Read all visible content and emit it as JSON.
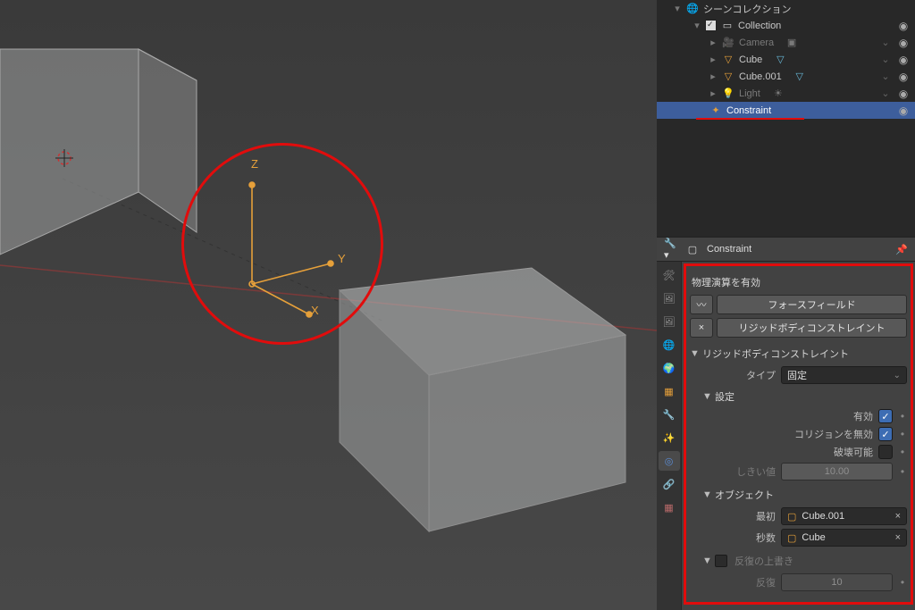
{
  "outliner": {
    "root": "シーンコレクション",
    "collection": "Collection",
    "items": [
      {
        "name": "Camera"
      },
      {
        "name": "Cube"
      },
      {
        "name": "Cube.001"
      },
      {
        "name": "Light"
      },
      {
        "name": "Constraint",
        "selected": true
      }
    ]
  },
  "viewport": {
    "axes": {
      "x": "X",
      "y": "Y",
      "z": "Z"
    }
  },
  "properties": {
    "context_object": "Constraint",
    "enable_section": "物理演算を有効",
    "buttons": {
      "force_field": "フォースフィールド",
      "rbc": "リジッドボディコンストレイント",
      "remove": "×"
    },
    "panel_title": "リジッドボディコンストレイント",
    "type_label": "タイプ",
    "type_value": "固定",
    "settings_label": "設定",
    "settings": {
      "enabled_label": "有効",
      "enabled": true,
      "disable_collisions_label": "コリジョンを無効",
      "disable_collisions": true,
      "breakable_label": "破壊可能",
      "breakable": false,
      "threshold_label": "しきい値",
      "threshold_value": "10.00"
    },
    "objects_label": "オブジェクト",
    "objects": {
      "first_label": "最初",
      "first_value": "Cube.001",
      "second_label": "秒数",
      "second_value": "Cube"
    },
    "override_label": "反復の上書き",
    "override": {
      "iter_label": "反復",
      "iter_value": "10"
    }
  }
}
